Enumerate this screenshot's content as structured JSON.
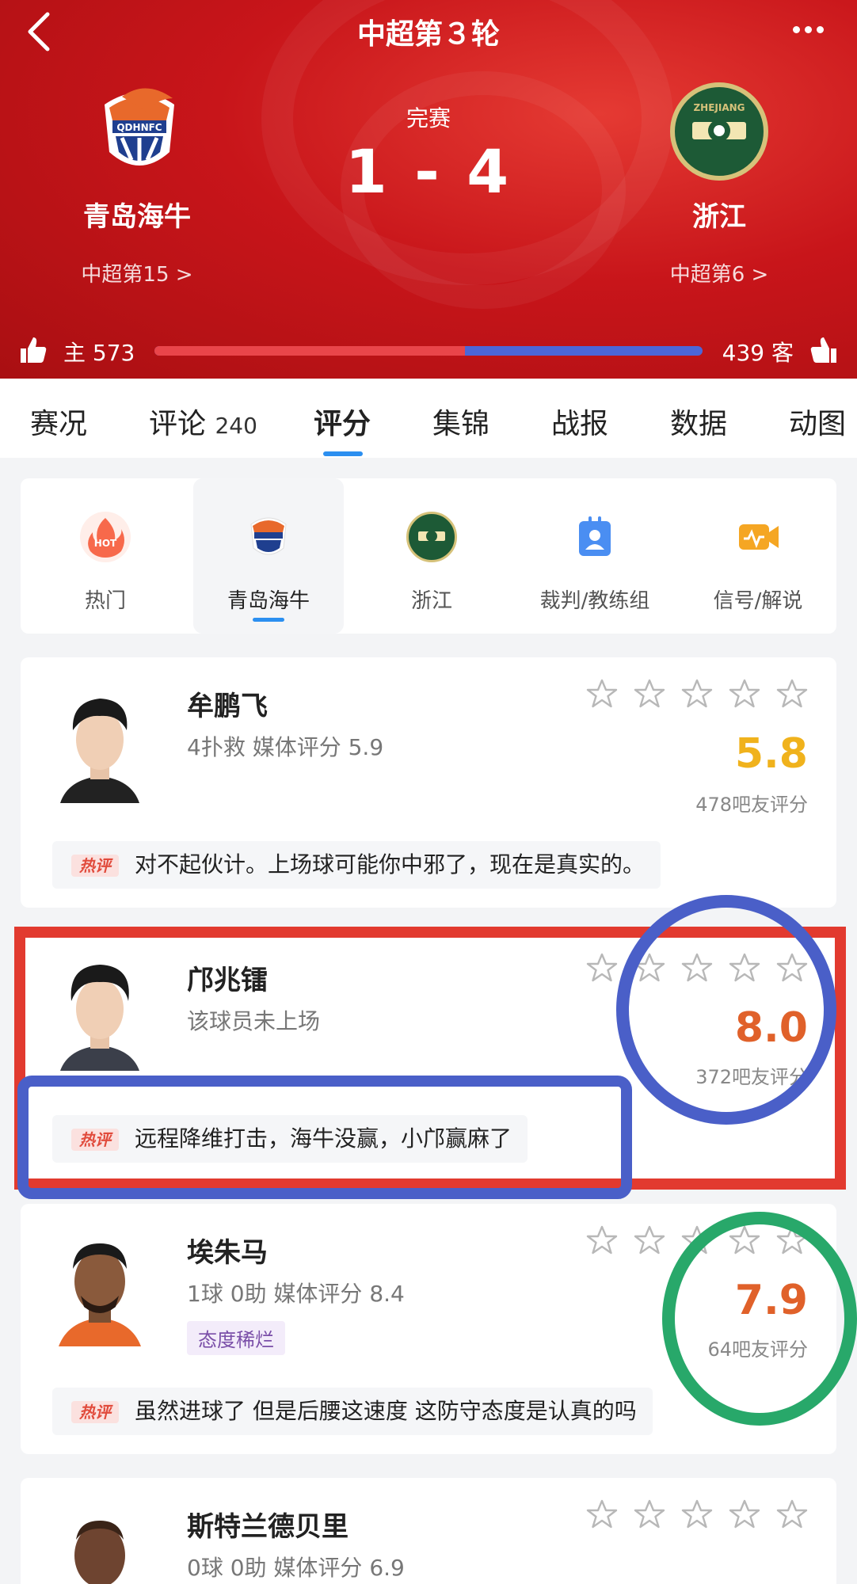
{
  "header": {
    "round_title": "中超第３轮",
    "status": "完赛",
    "score": "1 - 4",
    "home": {
      "name": "青岛海牛",
      "rank": "中超第15 >",
      "votes_label": "主 573",
      "logo_text": "QDHNFC"
    },
    "away": {
      "name": "浙江",
      "rank": "中超第6 >",
      "votes_label": "439 客",
      "logo_text": "ZHEJIANG"
    },
    "home_vote_fraction": 0.566
  },
  "tabs": [
    {
      "label": "赛况",
      "count": ""
    },
    {
      "label": "评论",
      "count": "240"
    },
    {
      "label": "评分",
      "count": "",
      "active": true
    },
    {
      "label": "集锦",
      "count": ""
    },
    {
      "label": "战报",
      "count": ""
    },
    {
      "label": "数据",
      "count": ""
    },
    {
      "label": "动图",
      "count": ""
    }
  ],
  "filters": [
    {
      "label": "热门",
      "icon": "hot-icon",
      "badge": "HOT"
    },
    {
      "label": "青岛海牛",
      "icon": "qingdao-logo-icon",
      "active": true
    },
    {
      "label": "浙江",
      "icon": "zhejiang-logo-icon"
    },
    {
      "label": "裁判/教练组",
      "icon": "referee-icon"
    },
    {
      "label": "信号/解说",
      "icon": "signal-icon"
    }
  ],
  "players": [
    {
      "name": "牟鹏飞",
      "stat": "4扑救  媒体评分 5.9",
      "tag": "",
      "fan_score": "5.8",
      "fan_count": "478吧友评分",
      "score_color": "#f0b21c",
      "comment_badge": "热评",
      "comment": "对不起伙计。上场球可能你中邪了，现在是真实的。"
    },
    {
      "name": "邝兆镭",
      "stat": "该球员未上场",
      "tag": "",
      "fan_score": "8.0",
      "fan_count": "372吧友评分",
      "score_color": "#e0612a",
      "comment_badge": "热评",
      "comment": "远程降维打击，海牛没赢，小邝赢麻了"
    },
    {
      "name": "埃朱马",
      "stat": "1球  0助   媒体评分 8.4",
      "tag": "态度稀烂",
      "fan_score": "7.9",
      "fan_count": "64吧友评分",
      "score_color": "#e0612a",
      "comment_badge": "热评",
      "comment": "虽然进球了 但是后腰这速度 这防守态度是认真的吗"
    },
    {
      "name": "斯特兰德贝里",
      "stat": "0球  0助   媒体评分 6.9",
      "tag": "",
      "fan_score": "",
      "fan_count": "",
      "score_color": "#e0612a",
      "comment_badge": "",
      "comment": ""
    }
  ]
}
